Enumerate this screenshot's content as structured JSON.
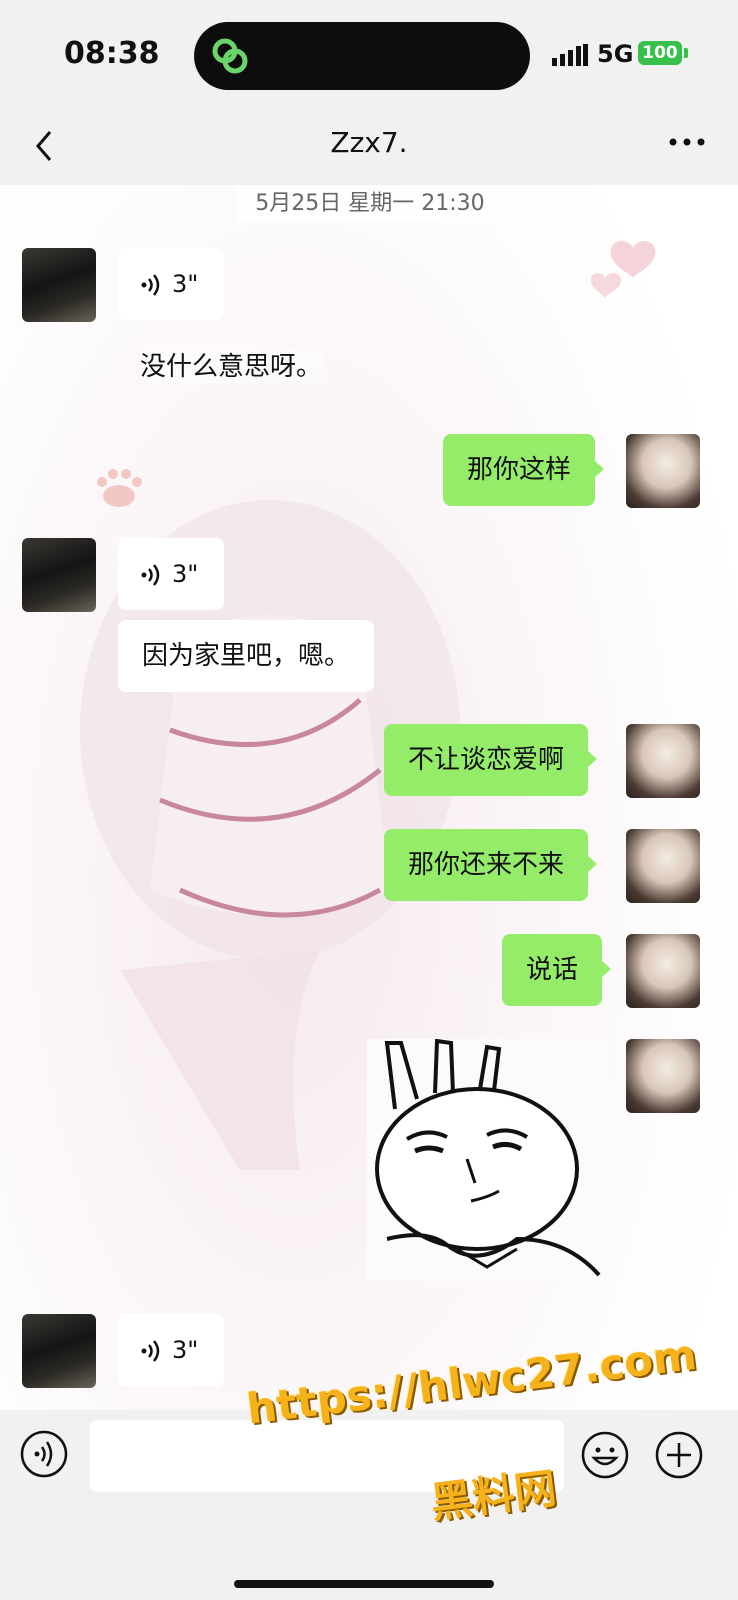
{
  "status": {
    "time": "08:38",
    "network": "5G",
    "battery": "100"
  },
  "header": {
    "title": "Zzx7."
  },
  "timestamp": "5月25日 星期一 21:30",
  "messages": [
    {
      "type": "voice",
      "duration": "3\""
    },
    {
      "type": "text",
      "text": "没什么意思呀。"
    },
    {
      "type": "text_out",
      "text": "那你这样"
    },
    {
      "type": "voice",
      "duration": "3\""
    },
    {
      "type": "text",
      "text": "因为家里吧，嗯。"
    },
    {
      "type": "text_out",
      "text": "不让谈恋爱啊"
    },
    {
      "type": "text_out",
      "text": "那你还来不来"
    },
    {
      "type": "text_out",
      "text": "说话"
    },
    {
      "type": "sticker",
      "icon": "bunny-sticker"
    },
    {
      "type": "voice",
      "duration": "3\""
    }
  ],
  "watermark": {
    "url": "https://hlwc27.com",
    "name": "黑料网"
  },
  "colors": {
    "outgoing_bubble": "#95ec69",
    "incoming_bubble": "#ffffff",
    "battery": "#37c14a"
  }
}
